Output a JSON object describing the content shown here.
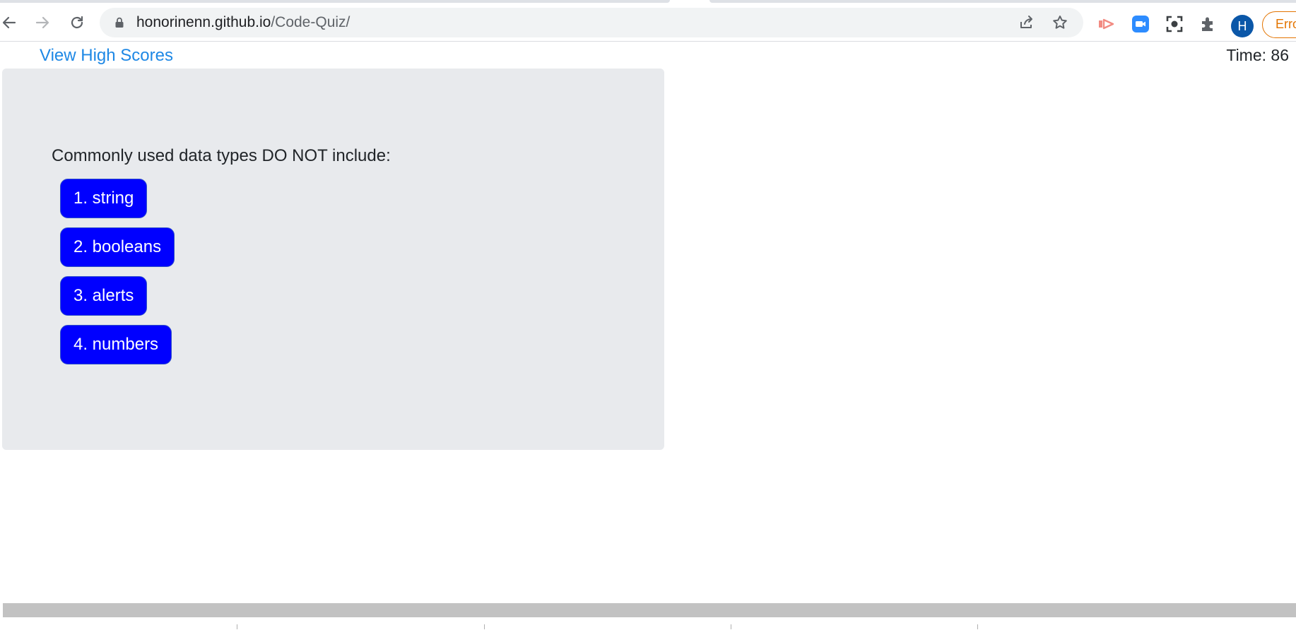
{
  "browser": {
    "url_host": "honorinenn.github.io",
    "url_path": "/Code-Quiz/",
    "profile_initial": "H",
    "error_chip_label": "Erro",
    "icons": [
      "back-arrow-icon",
      "forward-arrow-icon",
      "reload-icon",
      "lock-icon",
      "share-icon",
      "star-icon",
      "cast-extension-icon",
      "zoom-extension-icon",
      "screenshot-extension-icon",
      "puzzle-extensions-icon"
    ],
    "colors": {
      "error_accent": "#e37400",
      "avatar_bg": "#0b57a8",
      "omnibox_bg": "#f1f3f4"
    }
  },
  "header": {
    "high_scores_label": "View High Scores",
    "timer_text": "Time: 86"
  },
  "quiz": {
    "question": "Commonly used data types DO NOT include:",
    "choices": [
      {
        "label": "1. string"
      },
      {
        "label": "2. booleans"
      },
      {
        "label": "3. alerts"
      },
      {
        "label": "4. numbers"
      }
    ],
    "colors": {
      "card_bg": "#e8eaed",
      "choice_bg": "#0000ff",
      "choice_text": "#ffffff",
      "link": "#1e88e5"
    }
  }
}
